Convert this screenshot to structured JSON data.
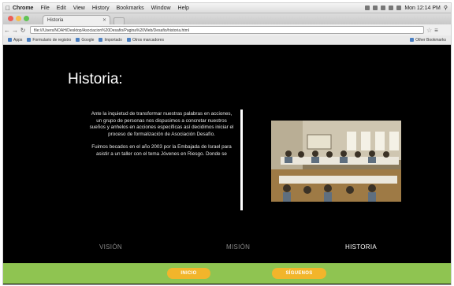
{
  "menubar": {
    "app": "Chrome",
    "items": [
      "File",
      "Edit",
      "View",
      "History",
      "Bookmarks",
      "Window",
      "Help"
    ],
    "clock": "Mon 12:14 PM"
  },
  "browser": {
    "tab_title": "Historia",
    "url": "file:///Users/NOAH/Desktop/Asociacion%20Desafio/Pagina%20Web/Desafio/historia.html",
    "bookmarks": [
      "Apps",
      "Formulario de registro",
      "Google",
      "Importado",
      "Otros marcadores"
    ],
    "bookmarks_right": "Other Bookmarks"
  },
  "page": {
    "title": "Historia:",
    "paragraphs": [
      "Ante la inquietud de transformar nuestras palabras en acciones, un grupo de personas nos dispusimos a concretar nuestros sueños y anhelos en acciones específicas así decidimos iniciar el proceso de formalización de Asociación Desafío.",
      "Fuimos becados en el año 2003 por la Embajada de Israel para asistir a un taller con el tema Jóvenes en Riesgo. Donde se"
    ],
    "photo_alt": "Classroom workshop photo",
    "sections": [
      "VISIÓN",
      "MISIÓN",
      "HISTORIA"
    ],
    "footer_buttons": [
      "INICIO",
      "SÍGUENOS"
    ]
  },
  "colors": {
    "page_bg": "#000000",
    "accent_green": "#8fc451",
    "button_orange": "#f2b52b"
  }
}
